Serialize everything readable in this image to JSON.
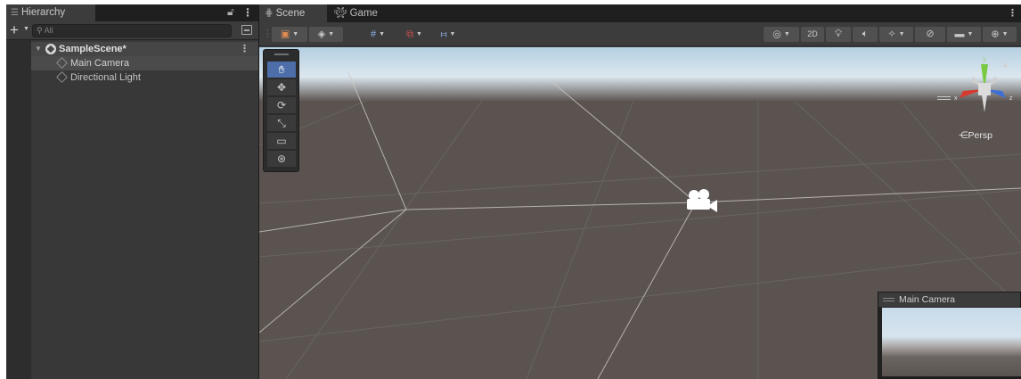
{
  "hierarchy": {
    "tab_title": "Hierarchy",
    "search_placeholder": "All",
    "add_label": "+",
    "scene_name": "SampleScene*",
    "items": [
      {
        "label": "Main Camera"
      },
      {
        "label": "Directional Light"
      }
    ]
  },
  "scene_view": {
    "tabs": [
      {
        "label": "Scene"
      },
      {
        "label": "Game"
      }
    ],
    "toolbar": {
      "mode_2d_label": "2D"
    },
    "gizmo": {
      "projection_label": "Persp",
      "axis_x": "x",
      "axis_y": "y",
      "axis_z": "z",
      "colors": {
        "x": "#d63a2f",
        "y": "#7ac943",
        "z": "#3d6fd6"
      }
    },
    "camera_preview": {
      "title": "Main Camera"
    },
    "colors": {
      "ground": "#5a5350",
      "sky": "#c8dbea",
      "panel": "#383838",
      "tab_bar": "#1f1f1f"
    }
  }
}
